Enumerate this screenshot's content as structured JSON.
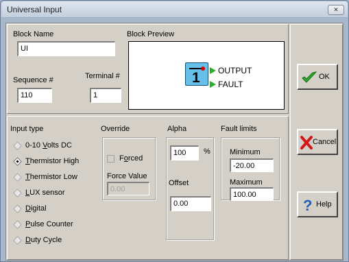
{
  "window": {
    "title": "Universal Input",
    "close_glyph": "✕"
  },
  "block": {
    "name_label": "Block Name",
    "name_value": "UI",
    "preview_label": "Block Preview",
    "sequence_label": "Sequence #",
    "sequence_value": "110",
    "terminal_label": "Terminal #",
    "terminal_value": "1",
    "preview": {
      "number": "1",
      "outputs": [
        "OUTPUT",
        "FAULT"
      ]
    }
  },
  "input_type": {
    "label": "Input type",
    "options": [
      {
        "pre": "0-10 ",
        "u": "V",
        "post": "olts DC",
        "selected": false
      },
      {
        "pre": "",
        "u": "T",
        "post": "hermistor High",
        "selected": true
      },
      {
        "pre": "",
        "u": "T",
        "post": "hermistor Low",
        "selected": false
      },
      {
        "pre": "",
        "u": "L",
        "post": "UX sensor",
        "selected": false
      },
      {
        "pre": "",
        "u": "D",
        "post": "igital",
        "selected": false
      },
      {
        "pre": "",
        "u": "P",
        "post": "ulse Counter",
        "selected": false
      },
      {
        "pre": "",
        "u": "D",
        "post": "uty Cycle",
        "selected": false
      }
    ]
  },
  "override": {
    "label": "Override",
    "forced_pre": "F",
    "forced_u": "o",
    "forced_post": "rced",
    "force_value_label": "Force Value",
    "force_value": "0.00"
  },
  "alpha": {
    "label": "Alpha",
    "value": "100",
    "unit": "%"
  },
  "offset": {
    "label": "Offset",
    "value": "0.00"
  },
  "fault_limits": {
    "label": "Fault limits",
    "minimum_label": "Minimum",
    "minimum_value": "-20.00",
    "maximum_label": "Maximum",
    "maximum_value": "100.00"
  },
  "buttons": {
    "ok": "OK",
    "cancel": "Cancel",
    "help": "Help"
  },
  "colors": {
    "accent_green": "#2eaa2e",
    "preview_blue": "#66c0ea",
    "cancel_red": "#d01818"
  }
}
